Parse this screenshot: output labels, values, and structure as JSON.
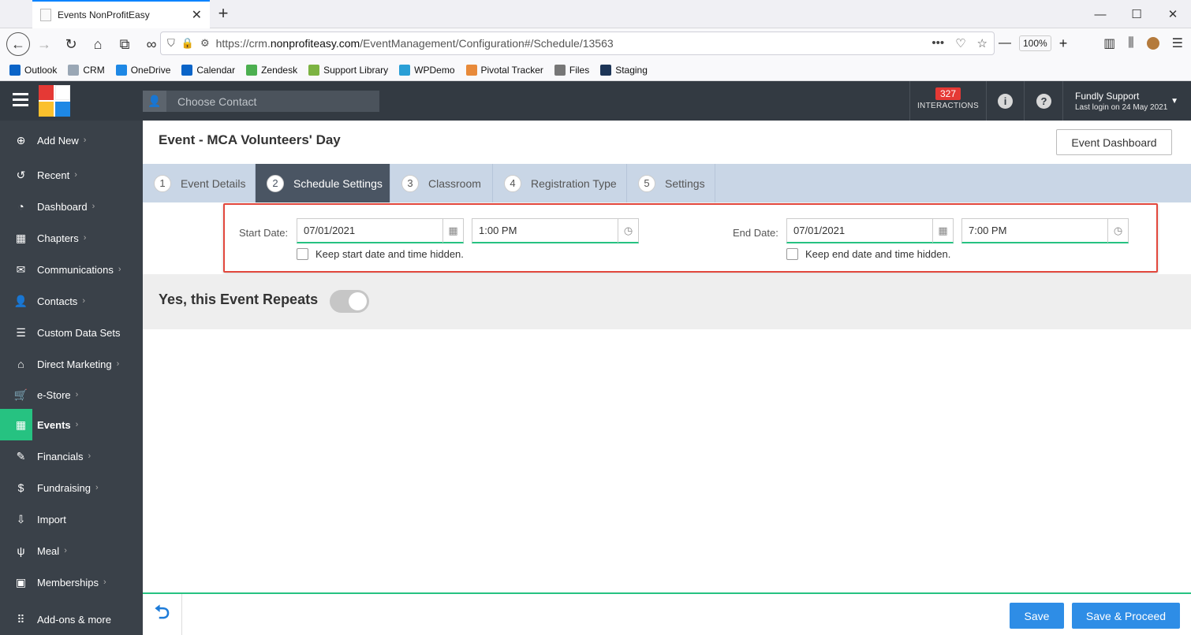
{
  "browser": {
    "tab_title": "Events NonProfitEasy",
    "url_prefix": "https://crm.",
    "url_domain": "nonprofiteasy.com",
    "url_path": "/EventManagement/Configuration#/Schedule/13563",
    "zoom": "100%",
    "bookmarks": [
      {
        "label": "Outlook",
        "color": "#0a64c8"
      },
      {
        "label": "CRM",
        "color": "#9aa7b5"
      },
      {
        "label": "OneDrive",
        "color": "#1e88e5"
      },
      {
        "label": "Calendar",
        "color": "#0a64c8"
      },
      {
        "label": "Zendesk",
        "color": "#4caf50"
      },
      {
        "label": "Support Library",
        "color": "#7cb342"
      },
      {
        "label": "WPDemo",
        "color": "#2a9fd6"
      },
      {
        "label": "Pivotal Tracker",
        "color": "#e88a3a"
      },
      {
        "label": "Files",
        "color": "#777777"
      },
      {
        "label": "Staging",
        "color": "#1d3557"
      }
    ]
  },
  "header": {
    "contact_placeholder": "Choose Contact",
    "interactions_count": "327",
    "interactions_label": "INTERACTIONS",
    "user_name": "Fundly Support",
    "last_login": "Last login on 24 May 2021"
  },
  "sidebar": {
    "items": [
      {
        "label": "Add New",
        "icon": "⊕",
        "chev": true
      },
      {
        "label": "Recent",
        "icon": "↺",
        "chev": true
      },
      {
        "label": "Dashboard",
        "icon": "◔",
        "chev": true
      },
      {
        "label": "Chapters",
        "icon": "▦",
        "chev": true
      },
      {
        "label": "Communications",
        "icon": "✉",
        "chev": true
      },
      {
        "label": "Contacts",
        "icon": "👤",
        "chev": true
      },
      {
        "label": "Custom Data Sets",
        "icon": "☰",
        "chev": false
      },
      {
        "label": "Direct Marketing",
        "icon": "⌂",
        "chev": true
      },
      {
        "label": "e-Store",
        "icon": "🛒",
        "chev": true
      },
      {
        "label": "Events",
        "icon": "▦",
        "chev": true,
        "active": true
      },
      {
        "label": "Financials",
        "icon": "✎",
        "chev": true
      },
      {
        "label": "Fundraising",
        "icon": "$",
        "chev": true
      },
      {
        "label": "Import",
        "icon": "⇩",
        "chev": false
      },
      {
        "label": "Meal",
        "icon": "ψ",
        "chev": true
      },
      {
        "label": "Memberships",
        "icon": "▣",
        "chev": true
      },
      {
        "label": "Add-ons & more",
        "icon": "⠿",
        "chev": false
      }
    ]
  },
  "main": {
    "page_title": "Event - MCA Volunteers' Day",
    "dashboard_button": "Event Dashboard",
    "steps": [
      {
        "num": "1",
        "label": "Event Details"
      },
      {
        "num": "2",
        "label": "Schedule Settings",
        "active": true
      },
      {
        "num": "3",
        "label": "Classroom"
      },
      {
        "num": "4",
        "label": "Registration Type"
      },
      {
        "num": "5",
        "label": "Settings"
      }
    ],
    "start": {
      "label": "Start Date:",
      "date": "07/01/2021",
      "time": "1:00 PM",
      "hidden_label": "Keep start date and time hidden."
    },
    "end": {
      "label": "End Date:",
      "date": "07/01/2021",
      "time": "7:00 PM",
      "hidden_label": "Keep end date and time hidden."
    },
    "repeat_label": "Yes, this Event Repeats",
    "save_label": "Save",
    "save_proceed_label": "Save & Proceed"
  }
}
